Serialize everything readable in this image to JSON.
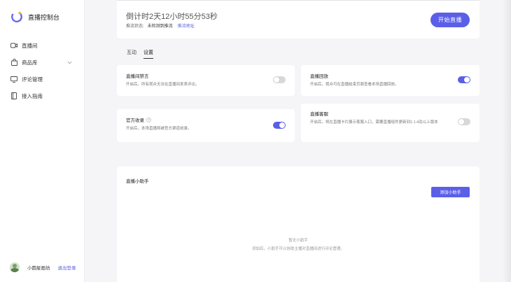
{
  "sidebar": {
    "brand_title": "直播控制台",
    "items": [
      {
        "label": "直播间",
        "icon": "video-icon"
      },
      {
        "label": "商品库",
        "icon": "bag-icon",
        "has_chevron": true
      },
      {
        "label": "评论管理",
        "icon": "monitor-icon"
      },
      {
        "label": "接入指南",
        "icon": "book-icon"
      }
    ],
    "user": {
      "name": "小圆星画坊",
      "logout_label": "退出登录"
    }
  },
  "countdown": {
    "text": "倒计时2天12小时55分53秒",
    "status_label": "推流状态:",
    "status_value": "未检测到推流",
    "status_link": "推流地址",
    "start_button": "开始直播"
  },
  "tabs": [
    {
      "label": "互动",
      "active": false
    },
    {
      "label": "设置",
      "active": true
    }
  ],
  "settings": [
    {
      "title": "直播间禁言",
      "desc": "开启后，所有观众无法在直播间发表评论。",
      "enabled": false
    },
    {
      "title": "直播回放",
      "desc": "开启后，观众可在直播结束页面查看本场直播回放。",
      "enabled": true
    },
    {
      "title": "官方收录",
      "desc": "开启后，本场直播将被官方渠道收录。",
      "enabled": true,
      "help_icon": true
    },
    {
      "title": "直播客服",
      "desc": "开启后，将在直播卡片展示客服入口，需要直播组件更新到1.1.4及以上版本",
      "enabled": false
    }
  ],
  "assistant": {
    "title": "直播小助手",
    "add_button": "添加小助手",
    "empty_title": "暂无小助手",
    "empty_desc": "添加后，小助手可以协助主播对直播间进行评论管理。"
  },
  "colors": {
    "accent": "#5b5fe8",
    "link": "#5a5fe0",
    "background": "#f5f5f7"
  }
}
